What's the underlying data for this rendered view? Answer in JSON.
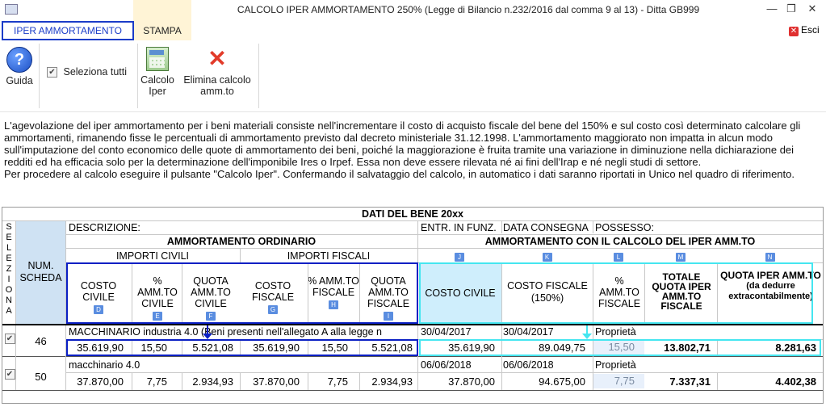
{
  "window": {
    "title": "CALCOLO IPER AMMORTAMENTO 250% (Legge di Bilancio n.232/2016 dal comma 9 al 13) - Ditta GB999"
  },
  "tabs": {
    "iper": "IPER AMMORTAMENTO",
    "stampa": "STAMPA"
  },
  "header_right": {
    "esci": "Esci"
  },
  "toolbar": {
    "guida": "Guida",
    "seleziona": "Seleziona tutti",
    "calcolo_line1": "Calcolo",
    "calcolo_line2": "Iper",
    "elimina_line1": "Elimina calcolo",
    "elimina_line2": "amm.to"
  },
  "description": {
    "p1": "L'agevolazione del iper ammortamento per i beni materiali consiste nell'incrementare il costo di acquisto fiscale del bene del 150% e sul costo così determinato calcolare gli ammortamenti, rimanendo fisse le percentuali di ammortamento previsto dal decreto ministeriale 31.12.1998. L'ammortamento maggiorato non impatta in alcun modo sull'imputazione del conto economico delle quote di ammortamento dei beni, poiché la maggiorazione è fruita tramite una variazione in diminuzione nella dichiarazione dei redditi ed ha efficacia solo per la determinazione dell'imponibile Ires o Irpef. Essa non deve essere rilevata né ai fini dell'Irap e né negli studi di settore.",
    "p2": "Per procedere al calcolo eseguire il pulsante \"Calcolo Iper\". Confermando il salvataggio del calcolo, in automatico i dati saranno riportati in Unico nel quadro di riferimento."
  },
  "table": {
    "title": "DATI DEL BENE 20xx",
    "selezionaV": "S E L E Z I O N A",
    "num_scheda": "NUM. SCHEDA",
    "descrizione": "DESCRIZIONE:",
    "entr_funz": "ENTR. IN FUNZ.",
    "data_consegna": "DATA CONSEGNA",
    "possesso": "POSSESSO:",
    "amm_ordinario": "AMMORTAMENTO ORDINARIO",
    "amm_iper": "AMMORTAMENTO CON IL CALCOLO DEL IPER AMM.TO",
    "importi_civili": "IMPORTI CIVILI",
    "importi_fiscali": "IMPORTI FISCALI",
    "cols": {
      "costo_civile": "COSTO CIVILE",
      "perc_civile": "% AMM.TO CIVILE",
      "quota_civile": "QUOTA AMM.TO CIVILE",
      "costo_fiscale": "COSTO FISCALE",
      "perc_fiscale": "% AMM.TO FISCALE",
      "quota_fiscale": "QUOTA AMM.TO FISCALE",
      "costo_civile_iper": "COSTO CIVILE",
      "costo_fiscale_150": "COSTO FISCALE (150%)",
      "perc_fiscale_iper": "% AMM.TO FISCALE",
      "totale_quota": "TOTALE QUOTA IPER AMM.TO FISCALE",
      "quota_iper": "QUOTA IPER AMM.TO",
      "quota_iper_sub": "(da dedurre extracontabilmente)"
    },
    "letters": {
      "D": "D",
      "E": "E",
      "F": "F",
      "G": "G",
      "H": "H",
      "I": "I",
      "J": "J",
      "K": "K",
      "L": "L",
      "M": "M",
      "N": "N"
    },
    "rows": [
      {
        "checked": "✔",
        "num": "46",
        "descrizione": "MACCHINARIO industria 4.0 (Beni presenti nell'allegato A alla legge n",
        "entr": "30/04/2017",
        "consegna": "30/04/2017",
        "possesso": "Proprietà",
        "costo_civile": "35.619,90",
        "perc_civile": "15,50",
        "quota_civile": "5.521,08",
        "costo_fiscale": "35.619,90",
        "perc_fiscale": "15,50",
        "quota_fiscale": "5.521,08",
        "costo_civile_iper": "35.619,90",
        "costo_fiscale_150": "89.049,75",
        "perc_iper": "15,50",
        "totale": "13.802,71",
        "quota_iper": "8.281,63"
      },
      {
        "checked": "✔",
        "num": "50",
        "descrizione": "macchinario 4.0",
        "entr": "06/06/2018",
        "consegna": "06/06/2018",
        "possesso": "Proprietà",
        "costo_civile": "37.870,00",
        "perc_civile": "7,75",
        "quota_civile": "2.934,93",
        "costo_fiscale": "37.870,00",
        "perc_fiscale": "7,75",
        "quota_fiscale": "2.934,93",
        "costo_civile_iper": "37.870,00",
        "costo_fiscale_150": "94.675,00",
        "perc_iper": "7,75",
        "totale": "7.337,31",
        "quota_iper": "4.402,38"
      }
    ]
  }
}
